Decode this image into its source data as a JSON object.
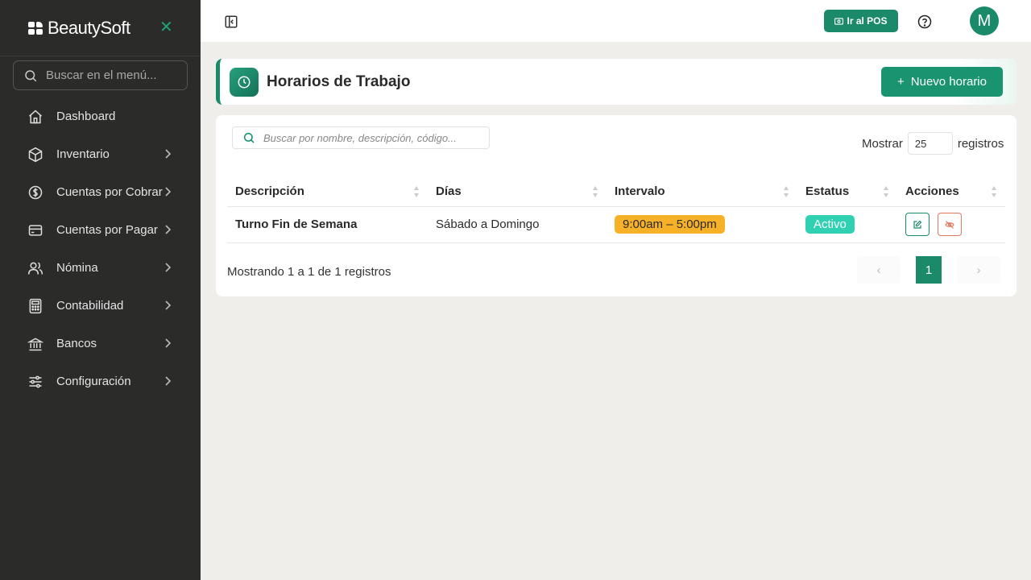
{
  "brand": {
    "name": "BeautySoft"
  },
  "sidebar": {
    "search_placeholder": "Buscar en el menú...",
    "items": [
      {
        "label": "Dashboard",
        "icon": "home-icon",
        "has_children": false
      },
      {
        "label": "Inventario",
        "icon": "box-icon",
        "has_children": true
      },
      {
        "label": "Cuentas por Cobrar",
        "icon": "dollar-circle-icon",
        "has_children": true
      },
      {
        "label": "Cuentas por Pagar",
        "icon": "credit-card-icon",
        "has_children": true
      },
      {
        "label": "Nómina",
        "icon": "users-icon",
        "has_children": true
      },
      {
        "label": "Contabilidad",
        "icon": "calculator-icon",
        "has_children": true
      },
      {
        "label": "Bancos",
        "icon": "bank-icon",
        "has_children": true
      },
      {
        "label": "Configuración",
        "icon": "sliders-icon",
        "has_children": true
      }
    ]
  },
  "topbar": {
    "pos_label": "Ir al POS",
    "avatar_initial": "M"
  },
  "page": {
    "title": "Horarios de Trabajo",
    "new_button": "Nuevo horario",
    "new_button_icon": "+",
    "search_placeholder": "Buscar por nombre, descripción, código...",
    "show_label": "Mostrar",
    "show_value": "25",
    "records_label": "registros",
    "table": {
      "headers": [
        "Descripción",
        "Días",
        "Intervalo",
        "Estatus",
        "Acciones"
      ],
      "rows": [
        {
          "descripcion": "Turno Fin de Semana",
          "dias": "Sábado a Domingo",
          "intervalo": "9:00am – 5:00pm",
          "estatus": "Activo"
        }
      ]
    },
    "showing_text": "Mostrando 1 a 1 de 1 registros",
    "pagination": {
      "prev": "‹",
      "current": "1",
      "next": "›"
    }
  },
  "colors": {
    "accent": "#1a8a6b",
    "sidebar_bg": "#2b2b2a",
    "interval_badge": "#f6b129",
    "status_badge": "#2fd1b2"
  }
}
